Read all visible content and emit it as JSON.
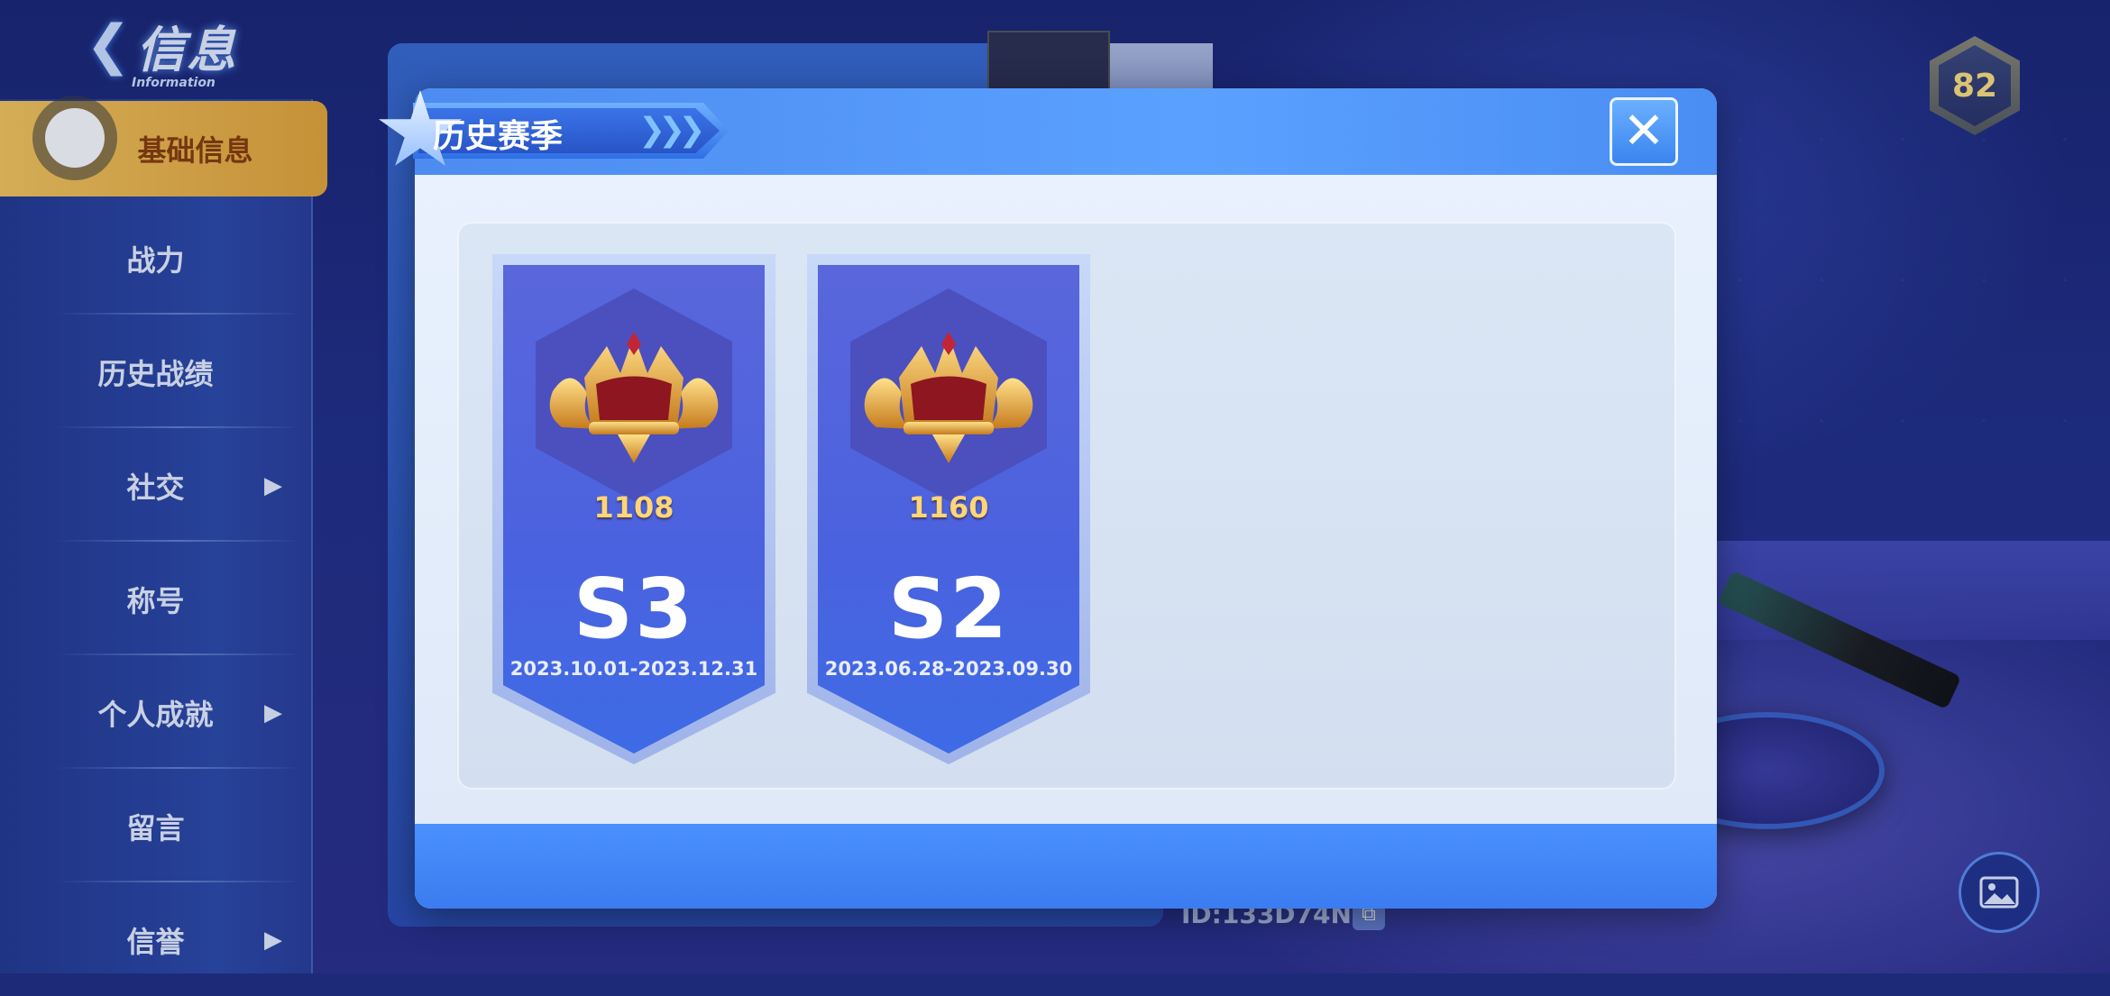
{
  "header": {
    "back_glyph": "❮",
    "title": "信息",
    "subtitle": "Information"
  },
  "sidebar": {
    "items": [
      {
        "label": "基础信息",
        "active": true,
        "has_arrow": false
      },
      {
        "label": "战力",
        "has_arrow": false
      },
      {
        "label": "历史战绩",
        "has_arrow": false
      },
      {
        "label": "社交",
        "has_arrow": true
      },
      {
        "label": "称号",
        "has_arrow": false
      },
      {
        "label": "个人成就",
        "has_arrow": true
      },
      {
        "label": "留言",
        "has_arrow": false
      },
      {
        "label": "信誉",
        "has_arrow": true
      }
    ],
    "arrow_glyph": "▶"
  },
  "level_badge": {
    "value": "82"
  },
  "profile": {
    "id_text": "ID:133D74N"
  },
  "modal": {
    "title": "历史赛季",
    "title_chevrons": "❯❯❯",
    "close_glyph": "✕",
    "seasons": [
      {
        "season": "S3",
        "score": "1108",
        "dates": "2023.10.01-2023.12.31"
      },
      {
        "season": "S2",
        "score": "1160",
        "dates": "2023.06.28-2023.09.30"
      }
    ]
  },
  "colors": {
    "accent_blue": "#4a8df3",
    "active_tab": "#f0b848",
    "score_gold": "#ffd676"
  },
  "icons": [
    "back-chevron-icon",
    "close-icon",
    "crown-icon",
    "image-icon",
    "copy-icon",
    "arrow-right-icon"
  ]
}
